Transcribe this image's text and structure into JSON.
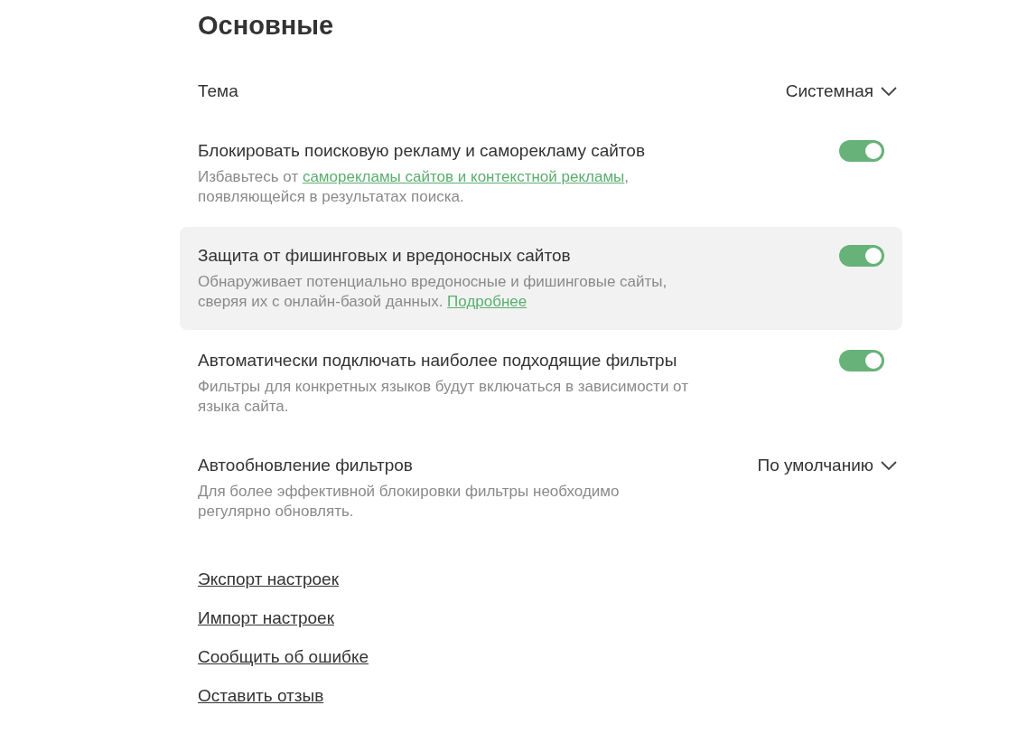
{
  "title": "Основные",
  "settings": [
    {
      "kind": "dropdown",
      "title": "Тема",
      "value": "Системная",
      "highlighted": false
    },
    {
      "kind": "toggle",
      "title": "Блокировать поисковую рекламу и саморекламу сайтов",
      "on": true,
      "highlighted": false,
      "description": [
        [
          {
            "text": "Избавьтесь от "
          },
          {
            "text": "саморекламы сайтов и контекстной рекламы",
            "link": true
          },
          {
            "text": ","
          }
        ],
        [
          {
            "text": "появляющейся в результатах поиска."
          }
        ]
      ]
    },
    {
      "kind": "toggle",
      "title": "Защита от фишинговых и вредоносных сайтов",
      "on": true,
      "highlighted": true,
      "description": [
        [
          {
            "text": "Обнаруживает потенциально вредоносные и фишинговые сайты,"
          }
        ],
        [
          {
            "text": "сверяя их с онлайн-базой данных. "
          },
          {
            "text": "Подробнее",
            "link": true
          }
        ]
      ]
    },
    {
      "kind": "toggle",
      "title": "Автоматически подключать наиболее подходящие фильтры",
      "on": true,
      "highlighted": false,
      "description": [
        [
          {
            "text": "Фильтры для конкретных языков будут включаться в зависимости от"
          }
        ],
        [
          {
            "text": "языка сайта."
          }
        ]
      ]
    },
    {
      "kind": "dropdown",
      "title": "Автообновление фильтров",
      "value": "По умолчанию",
      "highlighted": false,
      "description": [
        [
          {
            "text": "Для более эффективной блокировки фильтры необходимо"
          }
        ],
        [
          {
            "text": "регулярно обновлять."
          }
        ]
      ]
    }
  ],
  "links": [
    "Экспорт настроек",
    "Импорт настроек",
    "Сообщить об ошибке",
    "Оставить отзыв"
  ]
}
